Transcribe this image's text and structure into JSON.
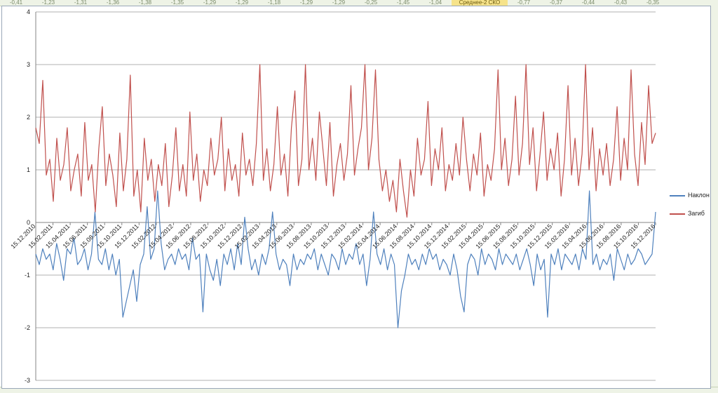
{
  "chart_data": {
    "type": "line",
    "title": "",
    "xlabel": "",
    "ylabel": "",
    "ylim": [
      -3,
      4
    ],
    "yticks": [
      -3,
      -2,
      -1,
      0,
      1,
      2,
      3,
      4
    ],
    "grid": "horizontal",
    "legend_position": "right",
    "x_range": [
      "15.12.2010",
      "15.12.2016"
    ],
    "x_tick_labels": [
      "15.12.2010",
      "15.02.2011",
      "15.04.2011",
      "15.06.2011",
      "15.08.2011",
      "15.10.2011",
      "15.12.2011",
      "15.02.2012",
      "15.04.2012",
      "15.06.2012",
      "15.08.2012",
      "15.10.2012",
      "15.12.2012",
      "15.02.2013",
      "15.04.2013",
      "15.06.2013",
      "15.08.2013",
      "15.10.2013",
      "15.12.2013",
      "15.02.2014",
      "15.04.2014",
      "15.06.2014",
      "15.08.2014",
      "15.10.2014",
      "15.12.2014",
      "15.02.2015",
      "15.04.2015",
      "15.06.2015",
      "15.08.2015",
      "15.10.2015",
      "15.12.2015",
      "15.02.2016",
      "15.04.2016",
      "15.06.2016",
      "15.08.2016",
      "15.10.2016",
      "15.12.2016"
    ],
    "series": [
      {
        "name": "Наклон",
        "color": "#4f81bd",
        "values": [
          -0.6,
          -0.8,
          -0.5,
          -0.7,
          -0.6,
          -0.9,
          -0.4,
          -0.7,
          -1.1,
          -0.5,
          -0.6,
          -0.3,
          -0.8,
          -0.7,
          -0.5,
          -0.9,
          -0.6,
          0.2,
          -0.7,
          -0.8,
          -0.5,
          -0.9,
          -0.6,
          -1.0,
          -0.7,
          -1.8,
          -1.5,
          -1.2,
          -0.9,
          -1.5,
          -0.8,
          -0.6,
          0.3,
          -0.7,
          -0.5,
          0.6,
          -0.4,
          -0.9,
          -0.7,
          -0.6,
          -0.8,
          -0.5,
          -0.7,
          -0.6,
          -0.9,
          -0.3,
          -0.7,
          -0.6,
          -1.7,
          -0.6,
          -0.9,
          -1.1,
          -0.7,
          -1.2,
          -0.6,
          -0.8,
          -0.5,
          -0.9,
          -0.4,
          -0.8,
          0.1,
          -0.5,
          -0.9,
          -0.7,
          -1.0,
          -0.6,
          -0.8,
          -0.5,
          0.2,
          -0.6,
          -0.9,
          -0.7,
          -0.8,
          -1.2,
          -0.6,
          -0.9,
          -0.7,
          -0.8,
          -0.6,
          -0.7,
          -0.5,
          -0.9,
          -0.6,
          -0.8,
          -1.0,
          -0.6,
          -0.7,
          -0.9,
          -0.5,
          -0.8,
          -0.6,
          -0.7,
          -0.4,
          -0.8,
          -0.6,
          -1.2,
          -0.7,
          0.2,
          -0.6,
          -0.8,
          -0.5,
          -0.9,
          -0.6,
          -0.8,
          -2.0,
          -1.3,
          -1.0,
          -0.6,
          -0.8,
          -0.7,
          -0.9,
          -0.6,
          -0.8,
          -0.5,
          -0.7,
          -0.6,
          -0.9,
          -0.7,
          -0.8,
          -1.0,
          -0.6,
          -0.9,
          -1.4,
          -1.7,
          -0.8,
          -0.6,
          -0.7,
          -1.0,
          -0.5,
          -0.8,
          -0.6,
          -0.7,
          -0.9,
          -0.5,
          -0.8,
          -0.6,
          -0.7,
          -0.8,
          -0.6,
          -0.9,
          -0.7,
          -0.5,
          -0.8,
          -1.2,
          -0.6,
          -0.9,
          -0.7,
          -1.8,
          -0.6,
          -0.8,
          -0.5,
          -0.9,
          -0.6,
          -0.7,
          -0.8,
          -0.6,
          -0.9,
          -0.5,
          -0.7,
          0.6,
          -0.8,
          -0.6,
          -0.9,
          -0.7,
          -0.8,
          -0.6,
          -1.1,
          -0.5,
          -0.7,
          -0.9,
          -0.6,
          -0.8,
          -0.7,
          -0.5,
          -0.6,
          -0.8,
          -0.7,
          -0.6,
          0.2
        ]
      },
      {
        "name": "Загиб",
        "color": "#c0504d",
        "values": [
          1.8,
          1.5,
          2.7,
          0.9,
          1.2,
          0.4,
          1.6,
          0.8,
          1.1,
          1.8,
          0.6,
          1.0,
          1.3,
          0.5,
          1.9,
          0.8,
          1.1,
          0.2,
          1.4,
          2.2,
          0.7,
          1.3,
          0.9,
          0.3,
          1.7,
          0.6,
          1.2,
          2.8,
          0.5,
          1.0,
          0.2,
          1.6,
          0.8,
          1.2,
          0.4,
          1.1,
          0.7,
          1.5,
          0.3,
          0.9,
          1.8,
          0.6,
          1.1,
          0.5,
          2.1,
          0.8,
          1.3,
          0.4,
          1.0,
          0.7,
          1.6,
          0.9,
          1.2,
          2.0,
          0.6,
          1.4,
          0.8,
          1.1,
          0.5,
          1.7,
          0.9,
          1.2,
          0.7,
          1.5,
          3.0,
          0.8,
          1.4,
          0.6,
          1.1,
          2.2,
          0.9,
          1.3,
          0.5,
          1.8,
          2.5,
          0.7,
          1.2,
          3.0,
          1.0,
          1.6,
          0.8,
          2.1,
          1.4,
          0.7,
          1.9,
          0.5,
          1.1,
          1.5,
          0.8,
          1.3,
          2.6,
          0.9,
          1.4,
          1.8,
          3.0,
          1.0,
          1.6,
          2.9,
          1.2,
          0.6,
          1.0,
          0.4,
          0.8,
          0.2,
          1.2,
          0.6,
          0.1,
          1.0,
          0.5,
          1.6,
          0.9,
          1.2,
          2.3,
          0.7,
          1.4,
          1.0,
          1.8,
          0.6,
          1.1,
          0.8,
          1.5,
          0.9,
          2.0,
          1.2,
          0.6,
          1.3,
          0.9,
          1.7,
          0.5,
          1.1,
          0.8,
          1.4,
          2.9,
          1.0,
          1.6,
          0.7,
          1.2,
          2.4,
          0.9,
          1.5,
          3.0,
          1.1,
          1.8,
          0.6,
          1.3,
          2.1,
          0.8,
          1.4,
          1.0,
          1.7,
          0.5,
          1.2,
          2.6,
          0.9,
          1.6,
          0.7,
          1.3,
          3.0,
          1.0,
          1.8,
          0.6,
          1.4,
          0.9,
          1.5,
          0.7,
          1.2,
          2.2,
          0.8,
          1.6,
          1.0,
          2.9,
          1.3,
          0.7,
          1.9,
          1.1,
          2.6,
          1.5,
          1.7
        ]
      }
    ]
  },
  "legend": {
    "items": [
      {
        "label": "Наклон",
        "color": "#4f81bd"
      },
      {
        "label": "Загиб",
        "color": "#c0504d"
      }
    ]
  },
  "spreadsheet": {
    "top_cells": [
      "-0,41",
      "-1,23",
      "-1,31",
      "-1,36",
      "-1,38",
      "-1,35",
      "-1,29",
      "-1,29",
      "-1,18",
      "-1,29",
      "-1,29",
      "-0,25",
      "-1,45",
      "-1,04",
      "Среднее-2 СКО",
      "-0,77",
      "-0,37",
      "-0,44",
      "-0,43",
      "-0,35"
    ]
  }
}
